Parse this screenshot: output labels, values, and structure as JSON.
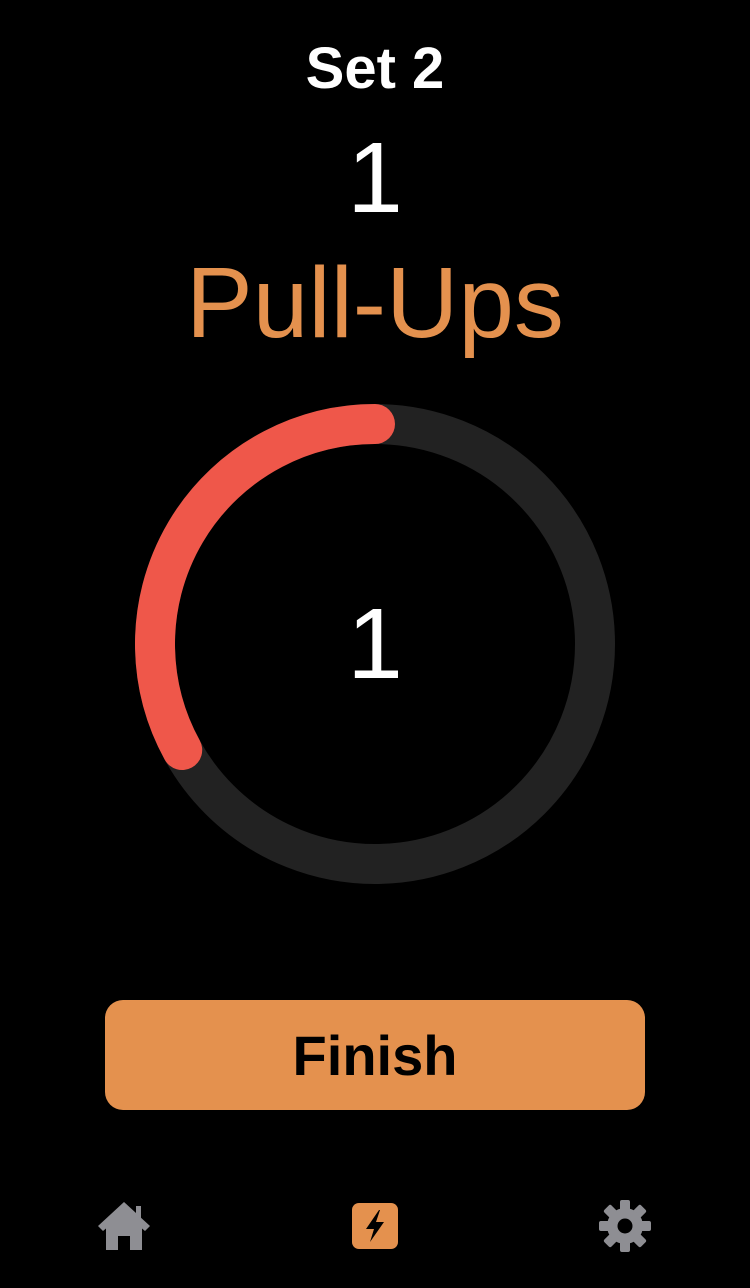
{
  "header": {
    "set_label": "Set 2",
    "rep_count": "1",
    "exercise_name": "Pull-Ups"
  },
  "timer": {
    "value": "1",
    "progress_fraction": 0.33
  },
  "actions": {
    "finish_label": "Finish"
  },
  "tabs": [
    {
      "icon": "home-icon",
      "active": false
    },
    {
      "icon": "bolt-icon",
      "active": true
    },
    {
      "icon": "gear-icon",
      "active": false
    }
  ],
  "colors": {
    "background": "#000000",
    "accent": "#E4914E",
    "progress": "#EF574A",
    "track": "#222222",
    "inactive_icon": "#8E8E93"
  }
}
